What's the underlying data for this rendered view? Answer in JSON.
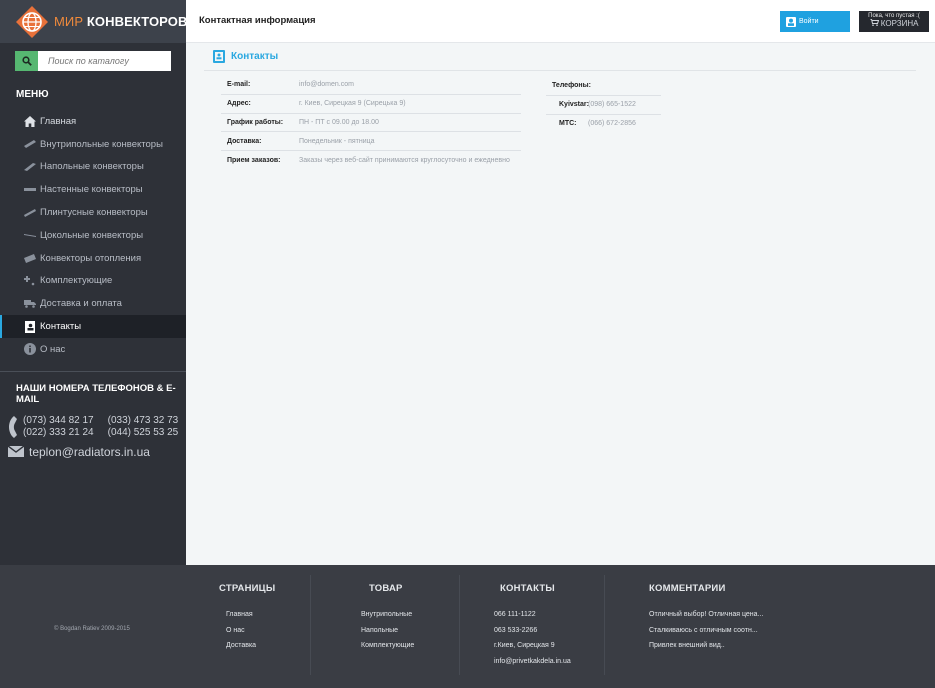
{
  "brand": {
    "name_accent": "МИР",
    "name_main": "КОНВЕКТОРОВ"
  },
  "search": {
    "placeholder": "Поиск по каталогу"
  },
  "menu": {
    "title": "МЕНЮ",
    "items": [
      {
        "label": "Главная",
        "icon": "home-icon"
      },
      {
        "label": "Внутрипольные конвекторы",
        "icon": "convector-icon"
      },
      {
        "label": "Напольные конвекторы",
        "icon": "convector-icon"
      },
      {
        "label": "Настенные конвекторы",
        "icon": "convector-icon"
      },
      {
        "label": "Плинтусные конвекторы",
        "icon": "convector-icon"
      },
      {
        "label": "Цокольные конвекторы",
        "icon": "convector-icon"
      },
      {
        "label": "Конвекторы отопления",
        "icon": "convector-icon"
      },
      {
        "label": "Комплектующие",
        "icon": "parts-icon"
      },
      {
        "label": "Доставка и оплата",
        "icon": "truck-icon"
      },
      {
        "label": "Контакты",
        "icon": "contacts-book-icon",
        "active": true
      },
      {
        "label": "О нас",
        "icon": "info-icon"
      }
    ]
  },
  "contacts_sidebar": {
    "title": "НАШИ НОМЕРА ТЕЛЕФОНОВ & E-MAIL",
    "phones_col1": [
      "(073) 344 82 17",
      "(022) 333 21 24"
    ],
    "phones_col2": [
      "(033) 473 32 73",
      "(044) 525 53 25"
    ],
    "email": "teplon@radiators.in.ua"
  },
  "header": {
    "title": "Контактная информация",
    "login_label": "Войти",
    "cart_status": "Пока, что пустая :(",
    "cart_label": "КОРЗИНА"
  },
  "section": {
    "title": "Контакты"
  },
  "info": [
    {
      "key": "E-mail:",
      "value": "info@domen.com"
    },
    {
      "key": "Адрес:",
      "value": "г. Киев, Сирецкая 9 (Сирецька 9)"
    },
    {
      "key": "График работы:",
      "value": "ПН - ПТ с 09.00 до 18.00"
    },
    {
      "key": "Доставка:",
      "value": "Понедельник - пятница"
    },
    {
      "key": "Прием заказов:",
      "value": "Заказы через веб-сайт принимаются круглосуточно и ежедневно"
    }
  ],
  "telephones": {
    "title": "Телефоны:",
    "rows": [
      {
        "key": "Kyivstar:",
        "value": "(098) 665-1522"
      },
      {
        "key": "МТС:",
        "value": "(066) 672-2856"
      }
    ]
  },
  "footer": {
    "copyright": "© Bogdan Ratiev 2009-2015",
    "pages": {
      "title": "СТРАНИЦЫ",
      "links": [
        "Главная",
        "О нас",
        "Доставка"
      ]
    },
    "goods": {
      "title": "ТОВАР",
      "links": [
        "Внутрипольные",
        "Напольные",
        "Комплектующие"
      ]
    },
    "contacts": {
      "title": "КОНТАКТЫ",
      "links": [
        "066 111-1122",
        "063 533-2266",
        "г.Киев, Сирецкая 9",
        "info@privetkakdela.in.ua"
      ]
    },
    "comments": {
      "title": "КОММЕНТАРИИ",
      "links": [
        "Отличный выбор! Отличная цена...",
        "Сталкиваюсь с отличным соотн...",
        "Привлек внешний вид.."
      ]
    }
  },
  "colors": {
    "accent": "#2aa8e0",
    "brand_orange": "#f08a3c",
    "search_green": "#56b771",
    "sidebar_bg": "#2e3138",
    "footer_bg": "#3a3d44"
  }
}
